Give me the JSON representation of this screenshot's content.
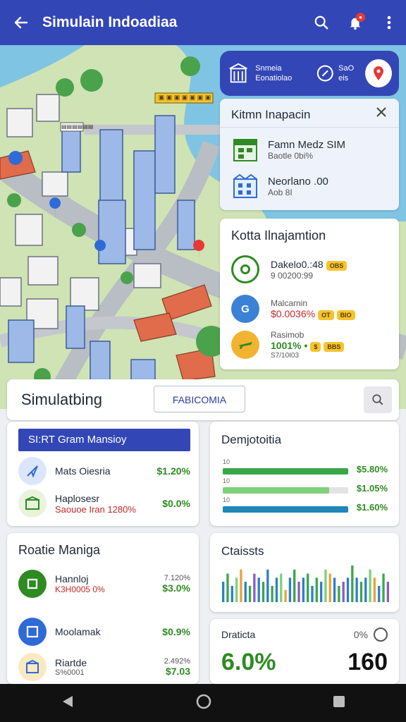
{
  "header": {
    "title": "Simulain Indoadiaa"
  },
  "map_panel": {
    "label1": "Snmeia",
    "label2": "Eonatiolao",
    "label3": "SaO",
    "label4": "eis"
  },
  "map_labels": {
    "tag": "▣ ▣ ▣ ▣ ▣ ▣ ▣",
    "small_tag": "▤▤▤▤▤▤"
  },
  "inspection_card": {
    "title": "Kitmn Inapacin",
    "items": [
      {
        "title": "Famn Medz SIM",
        "sub": "Baotle 0bi%"
      },
      {
        "title": "Neorlano .00",
        "sub": "Aob 8I"
      }
    ]
  },
  "info_card": {
    "title": "Kotta Ilnajamtion",
    "items": [
      {
        "title": "Dakelo0.:48",
        "value": "9 00200:99",
        "badges": [
          "OBS"
        ]
      },
      {
        "title": "Malcarnin",
        "value": "$0.0036%",
        "badges": [
          "OT",
          "BIO"
        ]
      },
      {
        "title": "Rasimob",
        "value": "1001% •",
        "badges": [
          "$",
          "BBS"
        ],
        "sub": "S7/10I03"
      }
    ]
  },
  "section_bar": {
    "title": "Simulatbing",
    "tab": "FABICOMIA"
  },
  "panel_a": {
    "header_button": "SI:RT Gram Mansioy",
    "items": [
      {
        "title": "Mats Oiesria",
        "value": "$1.20%"
      },
      {
        "title": "Haplosesr",
        "sub": "Saouoe Iran 1280%",
        "value": "$0.0%"
      }
    ]
  },
  "panel_b": {
    "title": "Demjotoitia",
    "rows": [
      {
        "label": "10",
        "fill": 1.0,
        "color": "#3aa64a",
        "value": "$5.80%"
      },
      {
        "label": "10",
        "fill": 0.85,
        "color": "#7ed07a",
        "value": "$1.05%"
      },
      {
        "label": "10",
        "fill": 1.0,
        "color": "#1f86b6",
        "value": "$1.60%"
      }
    ]
  },
  "panel_c": {
    "title": "Roatie Maniga",
    "items": [
      {
        "title": "Hannloj",
        "sub": "K3H0005 0%",
        "side": "7.120%",
        "value": "$3.0%"
      },
      {
        "title": "Moolamak",
        "value": "$0.9%"
      },
      {
        "title": "Riartde",
        "sub": "S%0001",
        "side": "2.492%",
        "value": "$7.03"
      }
    ]
  },
  "panel_d": {
    "title": "Ctaissts"
  },
  "panel_e": {
    "title": "Draticta",
    "pct": "0%",
    "value": "6.0%",
    "count": "160"
  },
  "chart_data": {
    "type": "bar",
    "values": [
      5,
      7,
      4,
      6,
      8,
      5,
      4,
      7,
      6,
      5,
      8,
      4,
      6,
      7,
      3,
      6,
      8,
      5,
      6,
      7,
      4,
      6,
      5,
      8,
      7,
      6,
      4,
      5,
      6,
      9,
      6,
      5,
      6,
      8,
      6,
      4,
      7,
      5
    ],
    "colors": [
      "#2f7fc4",
      "#3aa64a",
      "#2f7fc4",
      "#7ed07a",
      "#e7a33c",
      "#2f7fc4",
      "#3aa64a",
      "#8b5cc4",
      "#2f7fc4",
      "#3aa64a"
    ]
  }
}
